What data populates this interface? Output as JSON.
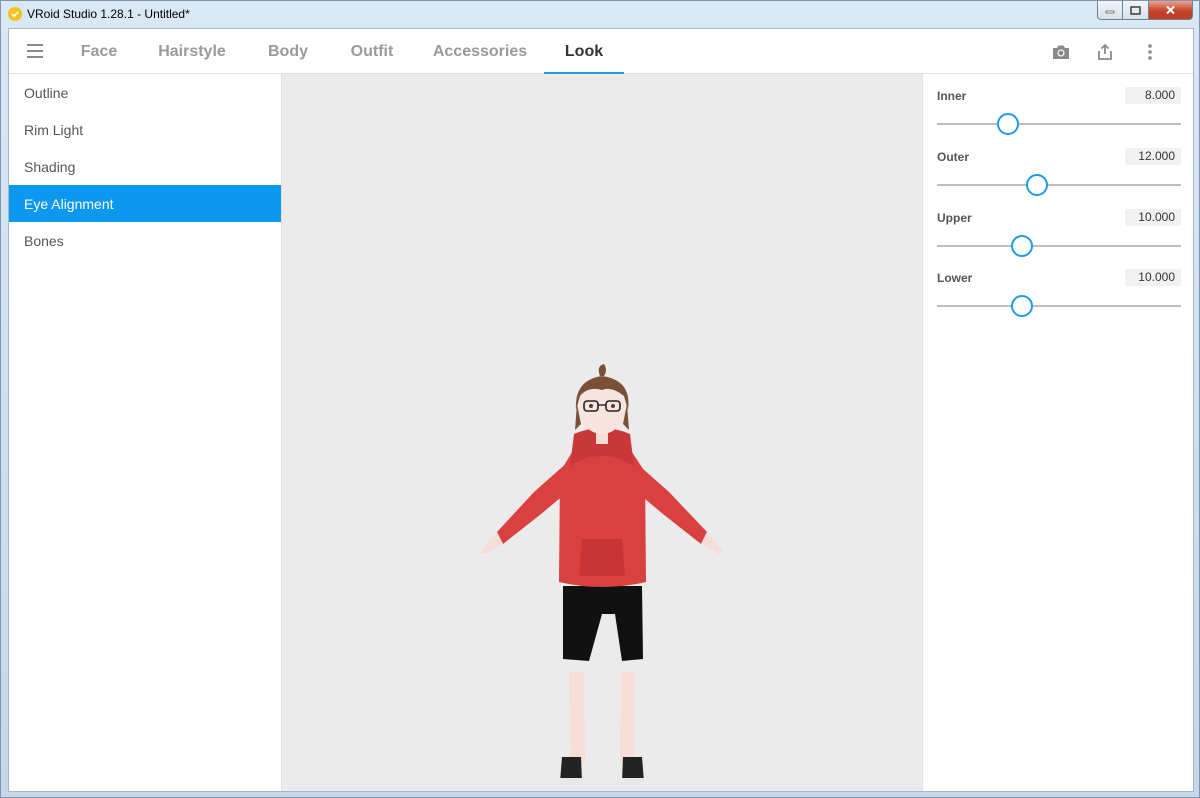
{
  "window": {
    "title": "VRoid Studio 1.28.1 - Untitled*"
  },
  "appbar": {
    "tabs": [
      {
        "label": "Face",
        "active": false
      },
      {
        "label": "Hairstyle",
        "active": false
      },
      {
        "label": "Body",
        "active": false
      },
      {
        "label": "Outfit",
        "active": false
      },
      {
        "label": "Accessories",
        "active": false
      },
      {
        "label": "Look",
        "active": true
      }
    ],
    "icons": [
      "menu-icon",
      "camera-icon",
      "share-icon",
      "more-vert-icon"
    ]
  },
  "left_menu": {
    "items": [
      {
        "label": "Outline",
        "selected": false
      },
      {
        "label": "Rim Light",
        "selected": false
      },
      {
        "label": "Shading",
        "selected": false
      },
      {
        "label": "Eye Alignment",
        "selected": true
      },
      {
        "label": "Bones",
        "selected": false
      }
    ]
  },
  "sliders": [
    {
      "label": "Inner",
      "value": "8.000",
      "level": 0.29
    },
    {
      "label": "Outer",
      "value": "12.000",
      "level": 0.41
    },
    {
      "label": "Upper",
      "value": "10.000",
      "level": 0.35
    },
    {
      "label": "Lower",
      "value": "10.000",
      "level": 0.35
    }
  ],
  "colors": {
    "accent": "#1e9be5",
    "selected_bg": "#0d98f0",
    "viewport_bg": "#ebebeb",
    "hoodie": "#d94040",
    "hair": "#7a5138"
  }
}
